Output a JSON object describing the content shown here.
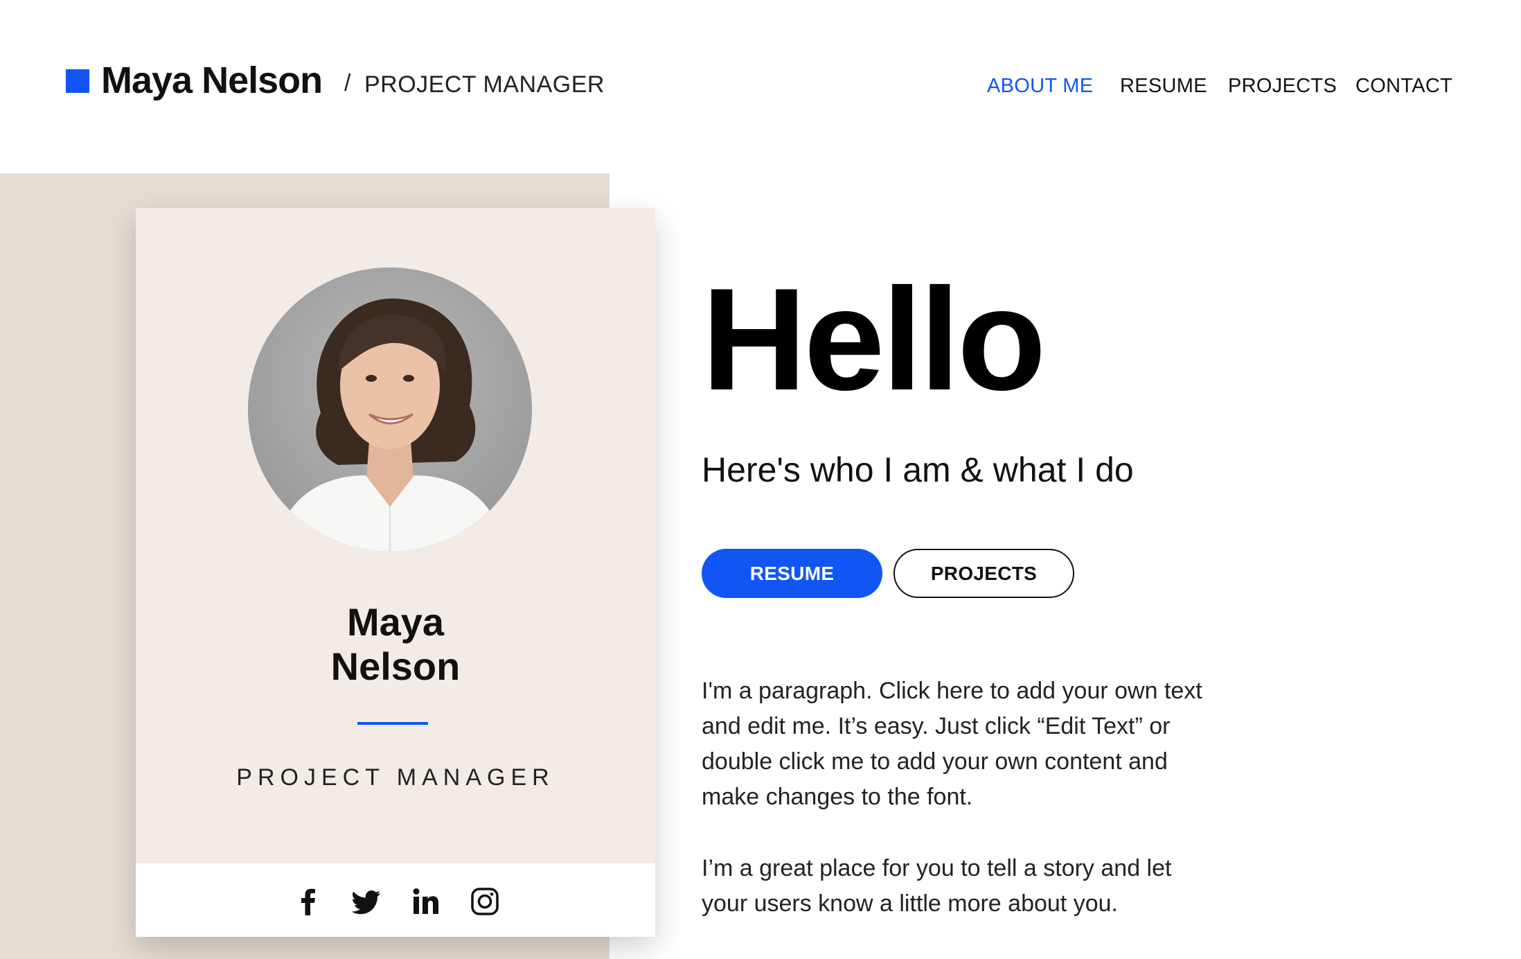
{
  "header": {
    "brand_name": "Maya Nelson",
    "separator": "/",
    "brand_role": "PROJECT MANAGER",
    "nav": [
      {
        "label": "ABOUT ME",
        "active": true
      },
      {
        "label": "RESUME",
        "active": false
      },
      {
        "label": "PROJECTS",
        "active": false
      },
      {
        "label": "CONTACT",
        "active": false
      }
    ]
  },
  "card": {
    "name_line1": "Maya",
    "name_line2": "Nelson",
    "role": "PROJECT MANAGER",
    "social_icons": [
      "facebook-icon",
      "twitter-icon",
      "linkedin-icon",
      "instagram-icon"
    ]
  },
  "hero": {
    "title": "Hello",
    "subtitle": "Here's who I am & what I do",
    "buttons": {
      "primary": "RESUME",
      "secondary": "PROJECTS"
    },
    "paragraph1_lines": [
      "I'm a paragraph. Click here to add your own text",
      "and edit me. It’s easy. Just click “Edit Text” or",
      "double click me to add your own content and",
      "make changes to the font."
    ],
    "paragraph2_lines": [
      "I’m a great place for you to tell a story and let",
      "your users know a little more about you."
    ]
  },
  "colors": {
    "accent": "#1155f5",
    "panel_bg": "#e5dcd3",
    "card_bg": "#f3ece6",
    "text": "#111111"
  }
}
